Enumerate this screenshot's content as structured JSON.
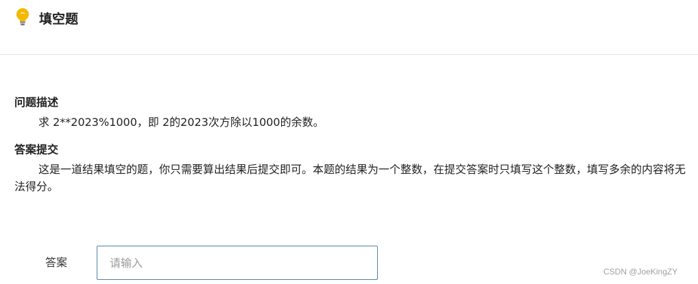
{
  "header": {
    "icon": "lightbulb-icon",
    "title": "填空题"
  },
  "problem": {
    "title": "问题描述",
    "text": "求 2**2023%1000，即 2的2023次方除以1000的余数。"
  },
  "submission": {
    "title": "答案提交",
    "text": "这是一道结果填空的题，你只需要算出结果后提交即可。本题的结果为一个整数，在提交答案时只填写这个整数，填写多余的内容将无法得分。"
  },
  "answer": {
    "label": "答案",
    "value": "",
    "placeholder": "请输入"
  },
  "watermark": "CSDN @JoeKingZY",
  "colors": {
    "bulb": "#f5b800",
    "input_border": "#4d7fa3",
    "divider": "#e3e3e3"
  }
}
